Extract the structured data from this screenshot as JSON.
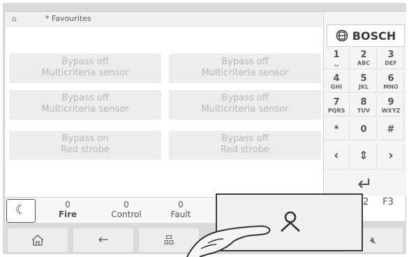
{
  "titlebar": {
    "title": "* Favourites"
  },
  "favourites": [
    {
      "line1": "Bypass off",
      "line2": "Multicriteria sensor"
    },
    {
      "line1": "Bypass off",
      "line2": "Multicriteria sensor"
    },
    {
      "line1": "Bypass off",
      "line2": "Multicriteria sensor"
    },
    {
      "line1": "Bypass off",
      "line2": "Multicriteria sensor"
    },
    {
      "line1": "Bypass on",
      "line2": "Red strobe"
    },
    {
      "line1": "Bypass off",
      "line2": "Red strobe"
    }
  ],
  "brand": "BOSCH",
  "keypad": [
    {
      "d": "1",
      "l": "␣"
    },
    {
      "d": "2",
      "l": "ABC"
    },
    {
      "d": "3",
      "l": "DEF"
    },
    {
      "d": "4",
      "l": "GHI"
    },
    {
      "d": "5",
      "l": "JKL"
    },
    {
      "d": "6",
      "l": "MNO"
    },
    {
      "d": "7",
      "l": "PQRS"
    },
    {
      "d": "8",
      "l": "TUV"
    },
    {
      "d": "9",
      "l": "WXYZ"
    },
    {
      "d": "*",
      "l": ""
    },
    {
      "d": "0",
      "l": ""
    },
    {
      "d": "#",
      "l": ""
    },
    {
      "d": "‹",
      "l": ""
    },
    {
      "d": "⇕",
      "l": ""
    },
    {
      "d": "›",
      "l": ""
    }
  ],
  "enter_symbol": "↵",
  "status": {
    "fire": {
      "count": "0",
      "label": "Fire"
    },
    "control": {
      "count": "0",
      "label": "Control"
    },
    "fault": {
      "count": "0",
      "label": "Fault"
    }
  },
  "function_keys": {
    "partial": "2",
    "f3": "F3"
  },
  "icons": {
    "moon": "☾",
    "home": "⌂",
    "back": "←",
    "network": "品",
    "mute": "🔇︎"
  }
}
